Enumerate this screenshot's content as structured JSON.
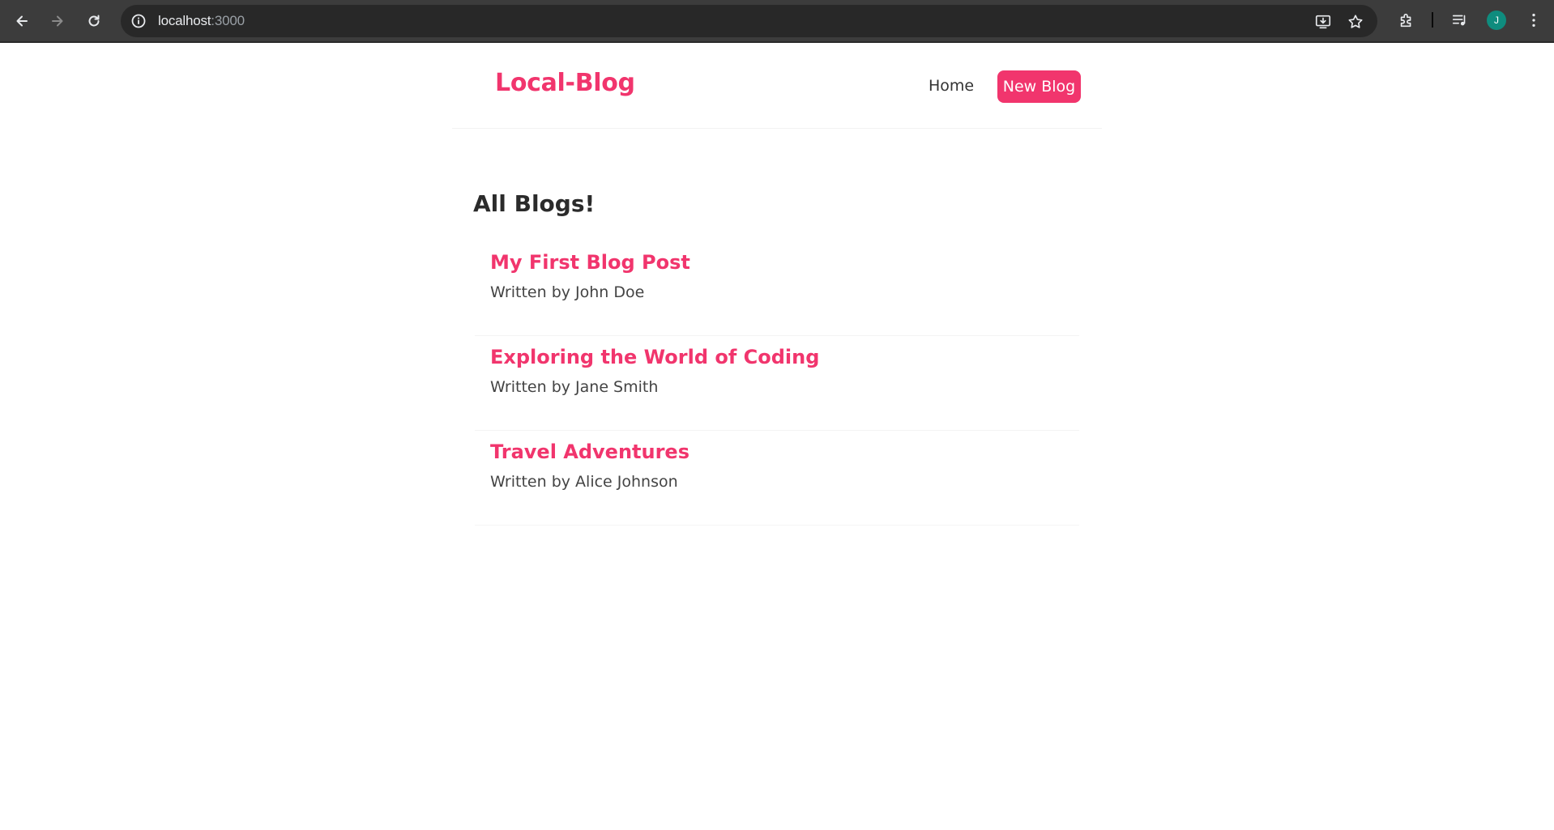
{
  "browser": {
    "url_host": "localhost",
    "url_port": ":3000",
    "profile_initial": "J",
    "icons": {
      "back": "arrow-left-icon",
      "forward": "arrow-right-icon",
      "reload": "reload-icon",
      "site_info": "info-icon",
      "install": "install-app-icon",
      "bookmark": "star-icon",
      "extensions": "puzzle-icon",
      "media": "media-queue-icon",
      "menu": "kebab-menu-icon"
    }
  },
  "navbar": {
    "brand": "Local-Blog",
    "links": [
      {
        "label": "Home"
      },
      {
        "label": "New Blog"
      }
    ]
  },
  "main": {
    "heading": "All Blogs!",
    "blogs": [
      {
        "title": "My First Blog Post",
        "byline": "Written by John Doe"
      },
      {
        "title": "Exploring the World of Coding",
        "byline": "Written by Jane Smith"
      },
      {
        "title": "Travel Adventures",
        "byline": "Written by Alice Johnson"
      }
    ]
  },
  "colors": {
    "accent": "#f1356d",
    "chrome_bg": "#3c3c3c",
    "omnibox_bg": "#282828",
    "avatar_bg": "#0f8c7e",
    "text_dark": "#333333"
  }
}
